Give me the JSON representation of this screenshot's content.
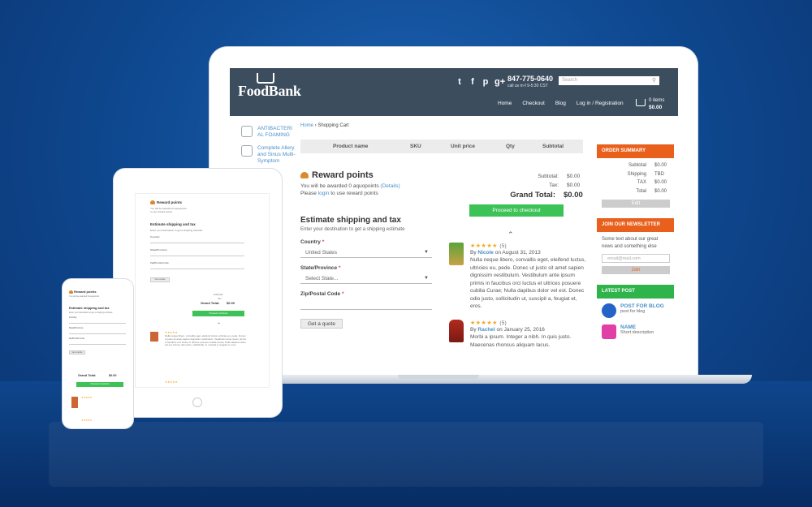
{
  "header": {
    "logo": "FoodBank",
    "phone": "847-775-0640",
    "phone_hours": "call us m-f 9-5:30 CST",
    "search_placeholder": "Search",
    "social": [
      "t",
      "f",
      "p",
      "g+"
    ],
    "nav": [
      "Home",
      "Checkout",
      "Blog",
      "Log in / Registration"
    ],
    "cart_items": "0 items",
    "cart_total": "$0.00"
  },
  "sidebar_left": {
    "items": [
      "ANTIBACTERI AL FOAMING",
      "Complete Allery and Sinus Multi-Symptom"
    ]
  },
  "breadcrumb": {
    "home": "Home",
    "current": "Shopping Cart"
  },
  "cart_table": {
    "columns": [
      "Product name",
      "SKU",
      "Unit price",
      "Qty",
      "Subtotal"
    ]
  },
  "reward": {
    "title": "Reward points",
    "line1": "You will be awarded 0 aquopoints",
    "details": "(Details)",
    "line2_pre": "Please",
    "login": "login",
    "line2_post": "to use reward points"
  },
  "estimate": {
    "title": "Estimate shipping and tax",
    "subtitle": "Enter your destination to get a shipping estimate",
    "country_label": "Country",
    "country_value": "United States",
    "state_label": "State/Province",
    "state_value": "Select State...",
    "zip_label": "Zip/Postal Code",
    "quote_button": "Get a quote"
  },
  "totals": {
    "subtotal_label": "Subtotal:",
    "subtotal": "$0.00",
    "tax_label": "Tax:",
    "tax": "$0.00",
    "grand_label": "Grand Total:",
    "grand": "$0.00",
    "checkout_button": "Proceed to checkout"
  },
  "reviews": [
    {
      "count": "(5)",
      "by": "By",
      "name": "Nicole",
      "date": "on August 31, 2013",
      "text": "Nulla neque libero, convallis eget, eleifend luctus, ultricies eu, pede. Donec ut justo sit amet sapien dignissim vestibulum. Vestibulum ante ipsum primis in faucibus orci luctus et ultrices posuere cubilia Curae; Nulla dapibus dolor vel est. Donec odio justo, sollicitudin ut, suscipit a, feugiat et, eros."
    },
    {
      "count": "(5)",
      "by": "By",
      "name": "Rachel",
      "date": "on January 25, 2016",
      "text": "Morbi a ipsum. Integer a nibh. In quis justo. Maecenas rhoncus aliquam lacus."
    }
  ],
  "order_summary": {
    "title": "ORDER SUMMARY",
    "rows": [
      {
        "label": "Subtotal",
        "value": "$0.00"
      },
      {
        "label": "Shipping",
        "value": "TBD"
      },
      {
        "label": "TAX",
        "value": "$0.00"
      },
      {
        "label": "Total",
        "value": "$0.00"
      }
    ],
    "edit_button": "Edit"
  },
  "newsletter": {
    "title": "JOIN OUR NEWSLETTER",
    "text": "Some text about our great news and something else",
    "placeholder": "email@mail.com",
    "join_button": "Join"
  },
  "latest_post": {
    "title": "LATEST POST",
    "posts": [
      {
        "title": "POST FOR BLOG",
        "desc": "post for blog"
      },
      {
        "title": "NAME",
        "desc": "Short description"
      }
    ]
  },
  "colors": {
    "header_bg": "#3c4d5e",
    "accent_orange": "#e8601c",
    "accent_green": "#3cc257",
    "link_blue": "#4a90c8",
    "background_blue": "#0f4a92"
  }
}
